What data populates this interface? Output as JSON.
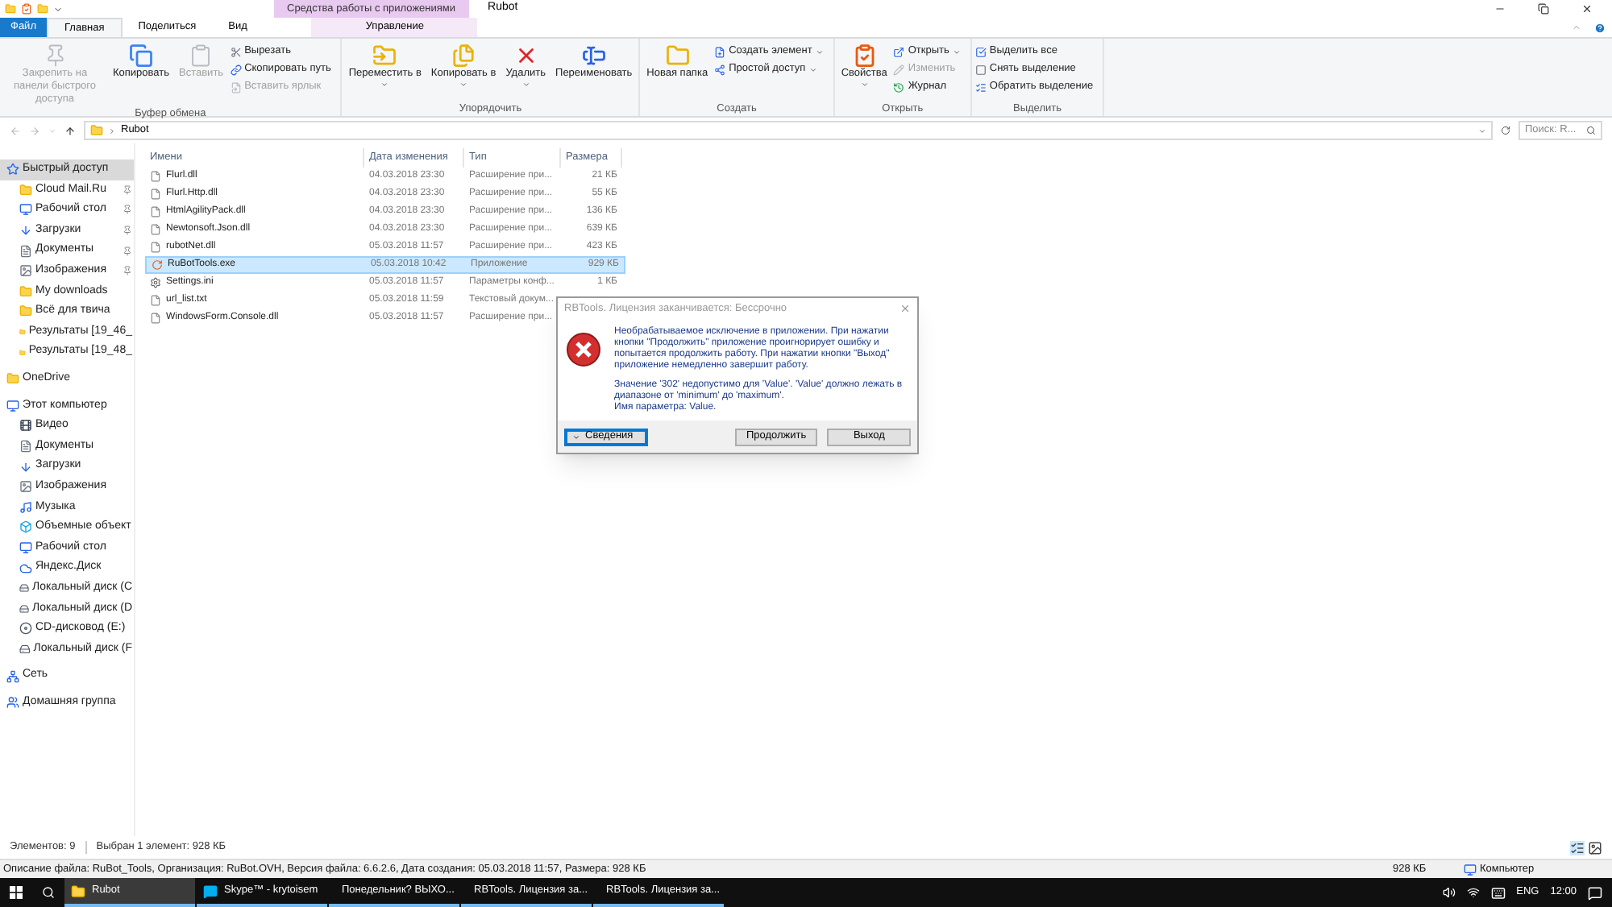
{
  "window": {
    "title": "Rubot",
    "context_header": "Средства работы с приложениями"
  },
  "ribbon": {
    "tabs": [
      {
        "label": "Файл",
        "kind": "file",
        "selected": false
      },
      {
        "label": "Главная",
        "kind": "normal",
        "selected": true
      },
      {
        "label": "Поделиться",
        "kind": "normal",
        "selected": false
      },
      {
        "label": "Вид",
        "kind": "normal",
        "selected": false
      },
      {
        "label": "Управление",
        "kind": "context",
        "selected": false
      }
    ],
    "groups": [
      {
        "label": "Буфер обмена",
        "items": [
          {
            "label": "Закрепить на панели быстрого доступа",
            "kind": "large",
            "disabled": true,
            "dropdown": false
          },
          {
            "label": "Копировать",
            "kind": "large",
            "disabled": false,
            "dropdown": false
          },
          {
            "label": "Вставить",
            "kind": "large",
            "disabled": true,
            "dropdown": false
          },
          {
            "label": "Вырезать",
            "kind": "small",
            "disabled": false,
            "dropdown": false
          },
          {
            "label": "Скопировать путь",
            "kind": "small",
            "disabled": false,
            "dropdown": false
          },
          {
            "label": "Вставить ярлык",
            "kind": "small",
            "disabled": true,
            "dropdown": false
          }
        ]
      },
      {
        "label": "Упорядочить",
        "items": [
          {
            "label": "Переместить в",
            "kind": "large",
            "disabled": false,
            "dropdown": true
          },
          {
            "label": "Копировать в",
            "kind": "large",
            "disabled": false,
            "dropdown": true
          },
          {
            "label": "Удалить",
            "kind": "large",
            "disabled": false,
            "dropdown": true
          },
          {
            "label": "Переименовать",
            "kind": "large",
            "disabled": false,
            "dropdown": false
          }
        ]
      },
      {
        "label": "Создать",
        "items": [
          {
            "label": "Новая папка",
            "kind": "large",
            "disabled": false,
            "dropdown": false
          },
          {
            "label": "Создать элемент",
            "kind": "small",
            "disabled": false,
            "dropdown": true
          },
          {
            "label": "Простой доступ",
            "kind": "small",
            "disabled": false,
            "dropdown": true
          }
        ]
      },
      {
        "label": "Открыть",
        "items": [
          {
            "label": "Свойства",
            "kind": "large",
            "disabled": false,
            "dropdown": true
          },
          {
            "label": "Открыть",
            "kind": "small",
            "disabled": false,
            "dropdown": true
          },
          {
            "label": "Изменить",
            "kind": "small",
            "disabled": true,
            "dropdown": false
          },
          {
            "label": "Журнал",
            "kind": "small",
            "disabled": false,
            "dropdown": false
          }
        ]
      },
      {
        "label": "Выделить",
        "items": [
          {
            "label": "Выделить все",
            "kind": "small",
            "disabled": false,
            "dropdown": false
          },
          {
            "label": "Снять выделение",
            "kind": "small",
            "disabled": false,
            "dropdown": false
          },
          {
            "label": "Обратить выделение",
            "kind": "small",
            "disabled": false,
            "dropdown": false
          }
        ]
      }
    ]
  },
  "address": {
    "path": "Rubot",
    "search_placeholder": "Поиск: R..."
  },
  "sidebar": {
    "items": [
      {
        "label": "Быстрый доступ",
        "kind": "star",
        "selected": true,
        "pinned": false,
        "children": [
          {
            "label": "Cloud Mail.Ru",
            "kind": "folder",
            "selected": false,
            "pinned": true
          },
          {
            "label": "Рабочий стол",
            "kind": "desktop",
            "selected": false,
            "pinned": true
          },
          {
            "label": "Загрузки",
            "kind": "download",
            "selected": false,
            "pinned": true
          },
          {
            "label": "Документы",
            "kind": "document",
            "selected": false,
            "pinned": true
          },
          {
            "label": "Изображения",
            "kind": "pictures",
            "selected": false,
            "pinned": true
          },
          {
            "label": "My downloads",
            "kind": "folder",
            "selected": false,
            "pinned": false
          },
          {
            "label": "Всё для твича",
            "kind": "folder",
            "selected": false,
            "pinned": false
          },
          {
            "label": "Результаты [19_46_",
            "kind": "folder",
            "selected": false,
            "pinned": false
          },
          {
            "label": "Результаты [19_48_",
            "kind": "folder",
            "selected": false,
            "pinned": false
          }
        ]
      },
      {
        "label": "OneDrive",
        "kind": "folder",
        "selected": false,
        "pinned": false
      },
      {
        "label": "Этот компьютер",
        "kind": "computer",
        "selected": false,
        "pinned": false,
        "children": [
          {
            "label": "Видео",
            "kind": "video",
            "selected": false,
            "pinned": false
          },
          {
            "label": "Документы",
            "kind": "document",
            "selected": false,
            "pinned": false
          },
          {
            "label": "Загрузки",
            "kind": "download",
            "selected": false,
            "pinned": false
          },
          {
            "label": "Изображения",
            "kind": "pictures",
            "selected": false,
            "pinned": false
          },
          {
            "label": "Музыка",
            "kind": "music",
            "selected": false,
            "pinned": false
          },
          {
            "label": "Объемные объект",
            "kind": "objects",
            "selected": false,
            "pinned": false
          },
          {
            "label": "Рабочий стол",
            "kind": "desktop",
            "selected": false,
            "pinned": false
          },
          {
            "label": "Яндекс.Диск",
            "kind": "cloud",
            "selected": false,
            "pinned": false
          },
          {
            "label": "Локальный диск (C",
            "kind": "drive",
            "selected": false,
            "pinned": false
          },
          {
            "label": "Локальный диск (D",
            "kind": "drive",
            "selected": false,
            "pinned": false
          },
          {
            "label": "CD-дисковод (E:)",
            "kind": "cd",
            "selected": false,
            "pinned": false
          },
          {
            "label": "Локальный диск (F",
            "kind": "drive",
            "selected": false,
            "pinned": false
          }
        ]
      },
      {
        "label": "Сеть",
        "kind": "network",
        "selected": false,
        "pinned": false
      },
      {
        "label": "Домашняя группа",
        "kind": "homegroup",
        "selected": false,
        "pinned": false
      }
    ]
  },
  "table": {
    "columns": [
      "Имени",
      "Дата изменения",
      "Тип",
      "Размера"
    ],
    "rows": [
      {
        "name": "Flurl.dll",
        "date": "04.03.2018 23:30",
        "type": "Расширение при...",
        "size": "21 КБ",
        "kind": "file",
        "selected": false
      },
      {
        "name": "Flurl.Http.dll",
        "date": "04.03.2018 23:30",
        "type": "Расширение при...",
        "size": "55 КБ",
        "kind": "file",
        "selected": false
      },
      {
        "name": "HtmlAgilityPack.dll",
        "date": "04.03.2018 23:30",
        "type": "Расширение при...",
        "size": "136 КБ",
        "kind": "file",
        "selected": false
      },
      {
        "name": "Newtonsoft.Json.dll",
        "date": "04.03.2018 23:30",
        "type": "Расширение при...",
        "size": "639 КБ",
        "kind": "file",
        "selected": false
      },
      {
        "name": "rubotNet.dll",
        "date": "05.03.2018 11:57",
        "type": "Расширение при...",
        "size": "423 КБ",
        "kind": "file",
        "selected": false
      },
      {
        "name": "RuBotTools.exe",
        "date": "05.03.2018 10:42",
        "type": "Приложение",
        "size": "929 КБ",
        "kind": "app",
        "selected": true
      },
      {
        "name": "Settings.ini",
        "date": "05.03.2018 11:57",
        "type": "Параметры конф...",
        "size": "1 КБ",
        "kind": "settings",
        "selected": false
      },
      {
        "name": "url_list.txt",
        "date": "05.03.2018 11:59",
        "type": "Текстовый докум...",
        "kind": "file",
        "selected": false
      },
      {
        "name": "WindowsForm.Console.dll",
        "date": "05.03.2018 11:57",
        "type": "Расширение при...",
        "kind": "file",
        "selected": false
      }
    ]
  },
  "dialog": {
    "title": "RBTools. Лицензия заканчивается: Бессрочно",
    "message": [
      "Необрабатываемое исключение в приложении. При нажатии кнопки \"Продолжить\" приложение проигнорирует ошибку и попытается продолжить работу. При нажатии кнопки \"Выход\" приложение немедленно завершит работу.",
      "Значение '302' недопустимо для 'Value'. 'Value' должно лежать в диапазоне от 'minimum' до 'maximum'.",
      "Имя параметра: Value."
    ],
    "buttons": [
      {
        "label": "Сведения",
        "kind": "details",
        "focused": true
      },
      {
        "label": "Продолжить",
        "kind": "normal",
        "focused": false
      },
      {
        "label": "Выход",
        "kind": "normal",
        "focused": false
      }
    ]
  },
  "status_bar": {
    "count": "Элементов: 9",
    "selection": "Выбран 1 элемент: 928 КБ"
  },
  "details_bar": {
    "description": "Описание файла: RuBot_Tools, Организация: RuBot.OVH, Версия файла: 6.6.2.6, Дата создания: 05.03.2018 11:57, Размера: 928 КБ",
    "size": "928 КБ",
    "location": "Компьютер"
  },
  "taskbar": {
    "items": [
      {
        "label": "Rubot",
        "kind": "folder",
        "selected": true
      },
      {
        "label": "Skype™ - krytoisem",
        "kind": "skype",
        "selected": false
      },
      {
        "label": "Понедельник? ВЫХО...",
        "kind": "browser",
        "selected": false
      },
      {
        "label": "RBTools. Лицензия за...",
        "kind": "app",
        "selected": false
      },
      {
        "label": "RBTools. Лицензия за...",
        "kind": "app",
        "selected": false
      }
    ],
    "language": "ENG",
    "time": "12:00"
  }
}
